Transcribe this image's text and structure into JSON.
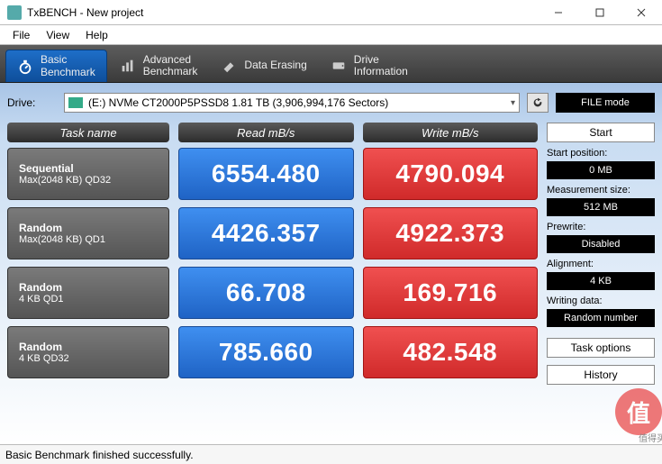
{
  "window": {
    "title": "TxBENCH - New project"
  },
  "menu": {
    "file": "File",
    "view": "View",
    "help": "Help"
  },
  "tabs": [
    {
      "label": "Basic\nBenchmark",
      "active": true
    },
    {
      "label": "Advanced\nBenchmark",
      "active": false
    },
    {
      "label": "Data Erasing",
      "active": false
    },
    {
      "label": "Drive\nInformation",
      "active": false
    }
  ],
  "drive": {
    "label": "Drive:",
    "selected": "(E:) NVMe CT2000P5PSSD8  1.81 TB (3,906,994,176 Sectors)"
  },
  "filemode_label": "FILE mode",
  "headers": {
    "task": "Task name",
    "read": "Read mB/s",
    "write": "Write mB/s"
  },
  "rows": [
    {
      "task1": "Sequential",
      "task2": "Max(2048 KB) QD32",
      "read": "6554.480",
      "write": "4790.094"
    },
    {
      "task1": "Random",
      "task2": "Max(2048 KB) QD1",
      "read": "4426.357",
      "write": "4922.373"
    },
    {
      "task1": "Random",
      "task2": "4 KB QD1",
      "read": "66.708",
      "write": "169.716"
    },
    {
      "task1": "Random",
      "task2": "4 KB QD32",
      "read": "785.660",
      "write": "482.548"
    }
  ],
  "side": {
    "start": "Start",
    "start_pos_lbl": "Start position:",
    "start_pos_val": "0 MB",
    "meas_lbl": "Measurement size:",
    "meas_val": "512 MB",
    "prewrite_lbl": "Prewrite:",
    "prewrite_val": "Disabled",
    "align_lbl": "Alignment:",
    "align_val": "4 KB",
    "writing_lbl": "Writing data:",
    "writing_val": "Random number",
    "task_opts": "Task options",
    "history": "History"
  },
  "status": "Basic Benchmark finished successfully.",
  "watermark": {
    "glyph": "值",
    "text": "值得买"
  }
}
